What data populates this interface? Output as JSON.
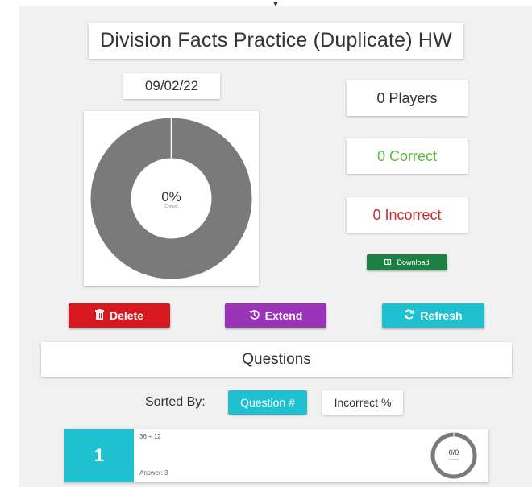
{
  "assignment": {
    "title": "Division Facts Practice (Duplicate) HW",
    "date": "09/02/22"
  },
  "summary_chart": {
    "percent_label": "0%",
    "sub_label": "Correct",
    "correct_fraction": 0,
    "ring_color": "#7a7a7a"
  },
  "stats": {
    "players": "0 Players",
    "correct": "0 Correct",
    "incorrect": "0 Incorrect",
    "correct_color": "#5cb83c",
    "incorrect_color": "#c9302c"
  },
  "download": {
    "label": "Download",
    "icon": "table-icon"
  },
  "actions": {
    "delete": {
      "label": "Delete",
      "icon": "trash-icon"
    },
    "extend": {
      "label": "Extend",
      "icon": "history-icon"
    },
    "refresh": {
      "label": "Refresh",
      "icon": "refresh-icon"
    }
  },
  "questions_header": "Questions",
  "sort": {
    "label": "Sorted By:",
    "options": [
      "Question #",
      "Incorrect %"
    ],
    "selected": "Question #"
  },
  "questions": [
    {
      "number": "1",
      "prompt": "36 ÷ 12",
      "answer": "Answer: 3",
      "score": "0/0",
      "score_sub": "Correct",
      "correct_fraction": 0
    }
  ],
  "colors": {
    "accent": "#1fc0cf",
    "delete": "#d7191f",
    "extend": "#9b33b8",
    "download": "#1e7f44"
  }
}
